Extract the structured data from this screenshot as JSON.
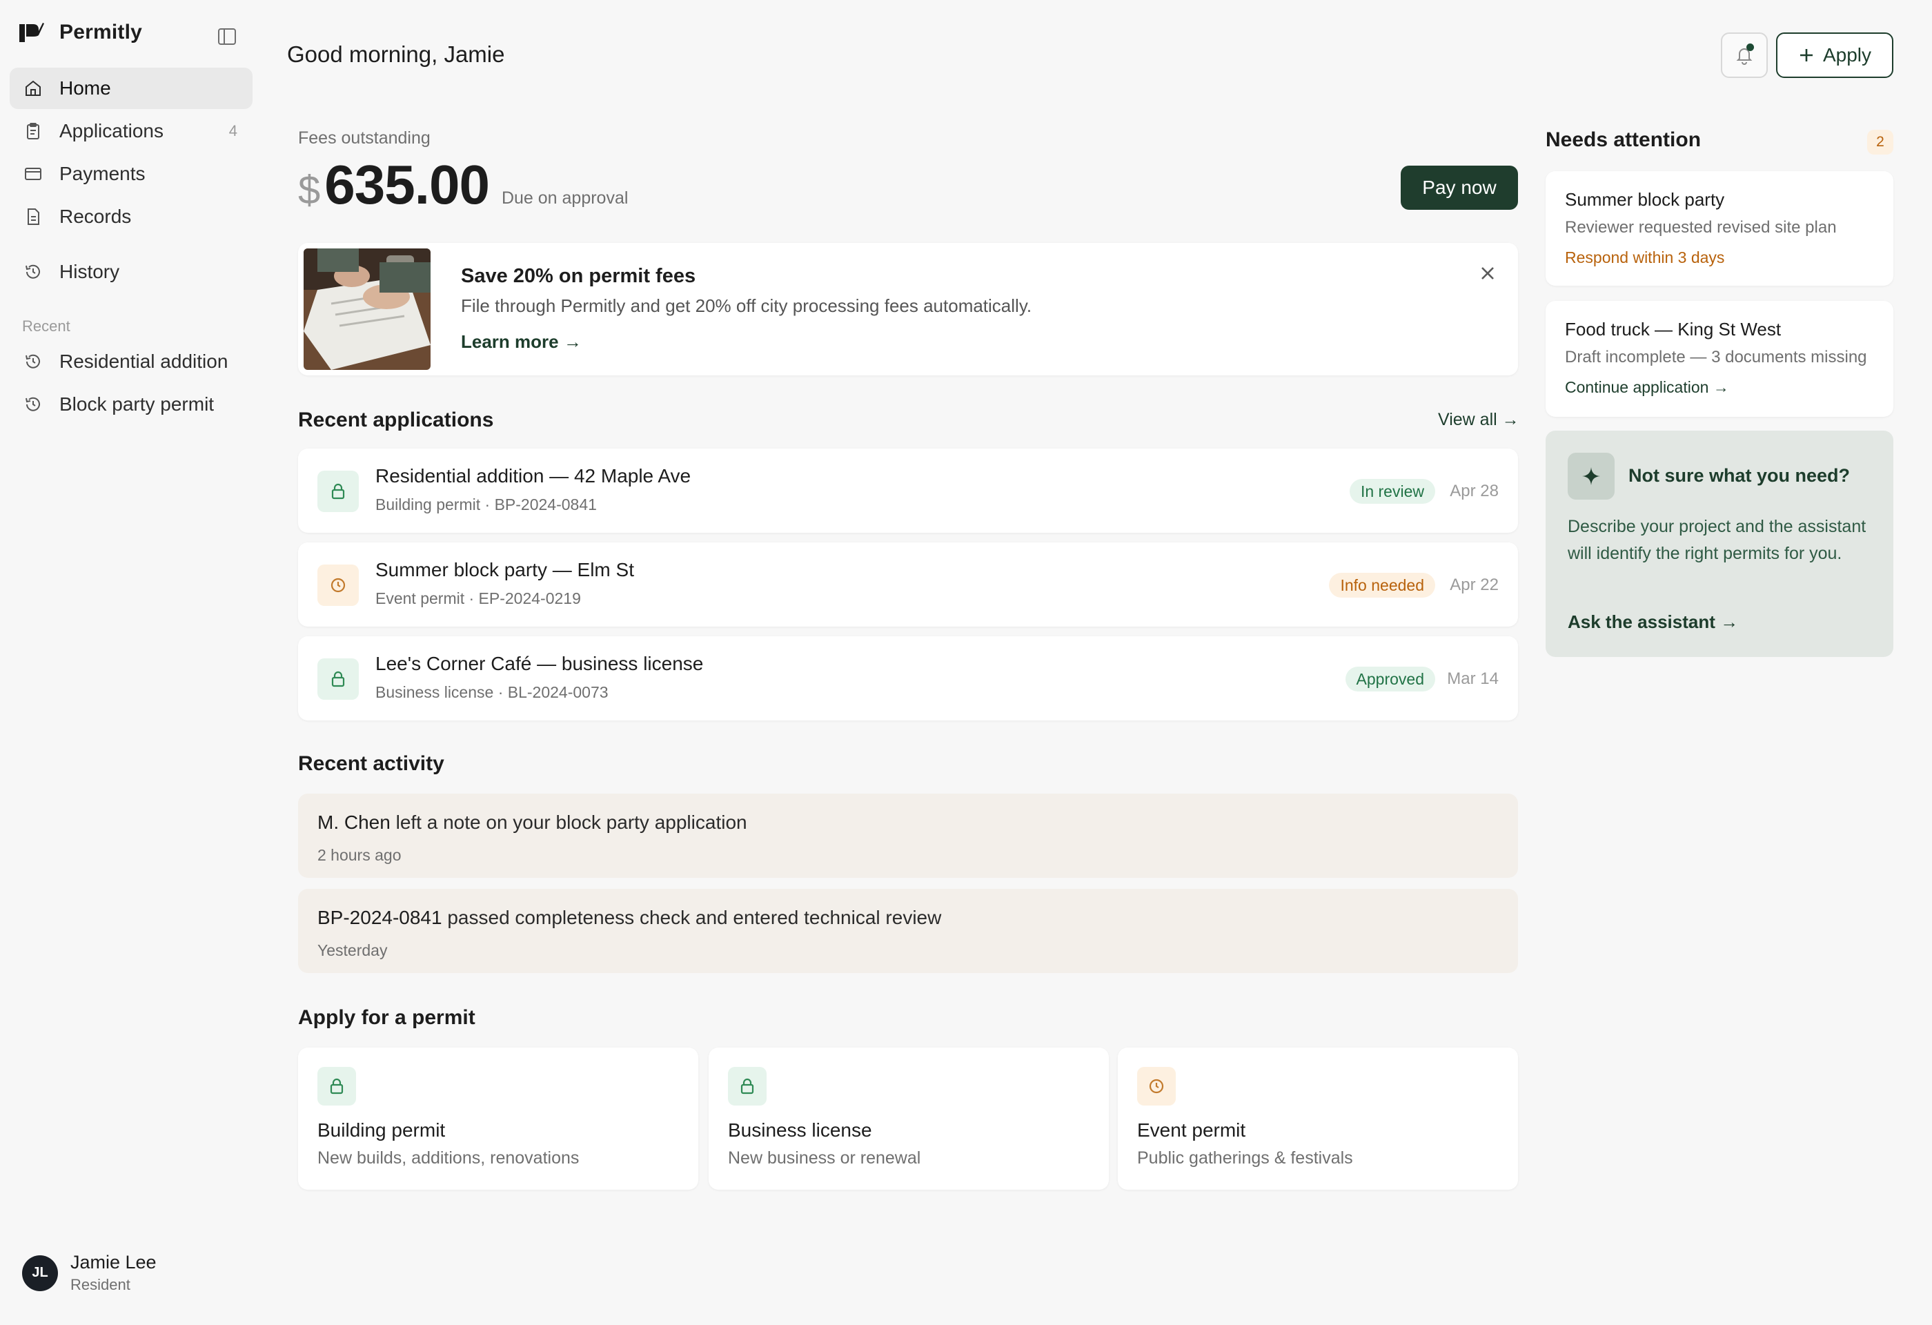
{
  "app": {
    "name": "Permitly"
  },
  "sidebar": {
    "nav": [
      {
        "label": "Home",
        "icon": "home-icon",
        "active": true
      },
      {
        "label": "Applications",
        "icon": "clipboard-icon",
        "count": "4"
      },
      {
        "label": "Payments",
        "icon": "card-icon"
      },
      {
        "label": "Records",
        "icon": "document-icon"
      },
      {
        "label": "History",
        "icon": "history-icon"
      }
    ],
    "recent_label": "Recent",
    "recent": [
      {
        "label": "Residential addition",
        "icon": "history-icon"
      },
      {
        "label": "Block party permit",
        "icon": "history-icon"
      }
    ],
    "user": {
      "initials": "JL",
      "name": "Jamie Lee",
      "role": "Resident"
    }
  },
  "header": {
    "greeting": "Good morning, Jamie",
    "apply_label": "Apply"
  },
  "fees": {
    "label": "Fees outstanding",
    "currency": "$",
    "amount": "635.00",
    "note": "Due on approval",
    "pay_label": "Pay now"
  },
  "promo": {
    "title": "Save 20% on permit fees",
    "text": "File through Permitly and get 20% off city processing fees automatically.",
    "link": "Learn more →"
  },
  "recent_apps": {
    "heading": "Recent applications",
    "view_all": "View all →",
    "items": [
      {
        "title": "Residential addition — 42 Maple Ave",
        "sub": "Building permit · BP-2024-0841",
        "status": "In review",
        "date": "Apr 28",
        "icon": "lock-icon"
      },
      {
        "title": "Summer block party — Elm St",
        "sub": "Event permit · EP-2024-0219",
        "status": "Info needed",
        "date": "Apr 22",
        "icon": "clock-icon"
      },
      {
        "title": "Lee's Corner Café — business license",
        "sub": "Business license · BL-2024-0073",
        "status": "Approved",
        "date": "Mar 14",
        "icon": "lock-icon"
      }
    ]
  },
  "activity": {
    "heading": "Recent activity",
    "items": [
      {
        "actor": "M. Chen",
        "text": " left a note on your block party application",
        "time": "2 hours ago"
      },
      {
        "actor": "BP-2024-0841",
        "text": " passed completeness check and entered technical review",
        "time": "Yesterday"
      }
    ]
  },
  "apply": {
    "heading": "Apply for a permit",
    "cards": [
      {
        "title": "Building permit",
        "sub": "New builds, additions, renovations",
        "icon": "lock-icon"
      },
      {
        "title": "Business license",
        "sub": "New business or renewal",
        "icon": "lock-icon"
      },
      {
        "title": "Event permit",
        "sub": "Public gatherings & festivals",
        "icon": "clock-icon"
      }
    ]
  },
  "attention": {
    "heading": "Needs attention",
    "count": "2",
    "items": [
      {
        "title": "Summer block party",
        "sub": "Reviewer requested revised site plan",
        "cta": "Respond within 3 days"
      },
      {
        "title": "Food truck — King St West",
        "sub": "Draft incomplete — 3 documents missing",
        "cta": "Continue application →"
      }
    ]
  },
  "assistant": {
    "title": "Not sure what you need?",
    "text": "Describe your project and the assistant will identify the right permits for you.",
    "link": "Ask the assistant →"
  },
  "colors": {
    "brand": "#1d3d2c",
    "accent_green": "#217346",
    "accent_amber": "#b8620c"
  }
}
